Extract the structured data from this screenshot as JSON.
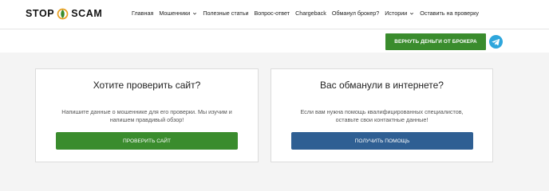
{
  "logo": {
    "left": "STOP",
    "right": "SCAM"
  },
  "nav": {
    "items": [
      {
        "label": "Главная",
        "dropdown": false
      },
      {
        "label": "Мошенники",
        "dropdown": true
      },
      {
        "label": "Полезные статьи",
        "dropdown": false
      },
      {
        "label": "Вопрос-ответ",
        "dropdown": false
      },
      {
        "label": "Chargeback",
        "dropdown": false
      },
      {
        "label": "Обманул брокер?",
        "dropdown": false
      },
      {
        "label": "Истории",
        "dropdown": true
      },
      {
        "label": "Оставить на проверку",
        "dropdown": false
      }
    ]
  },
  "refund_button": {
    "label": "ВЕРНУТЬ ДЕНЬГИ ОТ БРОКЕРА",
    "color": "#3a8c2d"
  },
  "telegram": {
    "icon": "telegram-icon",
    "color": "#2ea6dc"
  },
  "cards": [
    {
      "title": "Хотите проверить сайт?",
      "description": "Напишите данные о мошеннике для его проверки. Мы изучим и напишем правдивый обзор!",
      "button": "ПРОВЕРИТЬ САЙТ",
      "button_color": "#3a8c2d"
    },
    {
      "title": "Вас обманули в интернете?",
      "description": "Если вам нужна помощь квалифицированных специалистов, оставьте свои контактные данные!",
      "button": "ПОЛУЧИТЬ ПОМОЩЬ",
      "button_color": "#2f5f93"
    }
  ]
}
